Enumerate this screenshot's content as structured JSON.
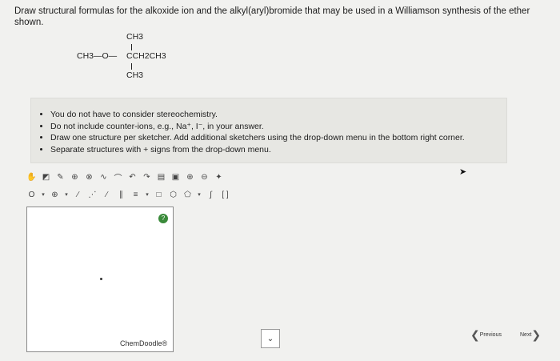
{
  "question": {
    "text": "Draw structural formulas for the alkoxide ion and the alkyl(aryl)bromide that may be used in a Williamson synthesis of the ether shown."
  },
  "structure": {
    "left_group": "CH3—O—",
    "center": "CCH2CH3",
    "top": "CH3",
    "bottom": "CH3"
  },
  "instructions": [
    "You do not have to consider stereochemistry.",
    "Do not include counter-ions, e.g., Na⁺, I⁻, in your answer.",
    "Draw one structure per sketcher. Add additional sketchers using the drop-down menu in the bottom right corner.",
    "Separate structures with + signs from the drop-down menu."
  ],
  "toolbar_row1": [
    "hand-icon",
    "eraser-icon",
    "pencil-icon",
    "ring-plus-icon",
    "atom-charge-icon",
    "chain-icon",
    "lasso-icon",
    "undo-icon",
    "redo-icon",
    "template-icon",
    "clear-icon",
    "zoom-in-icon",
    "zoom-out-icon",
    "clean-icon"
  ],
  "toolbar_row2": {
    "atom_label": "O",
    "charge_label": "⊕",
    "dropdown_glyph": "▾"
  },
  "sketcher": {
    "help_label": "?",
    "brand": "ChemDoodle®"
  },
  "nav": {
    "previous": "Previous",
    "next": "Next"
  },
  "dropdown_glyph": "⌄"
}
